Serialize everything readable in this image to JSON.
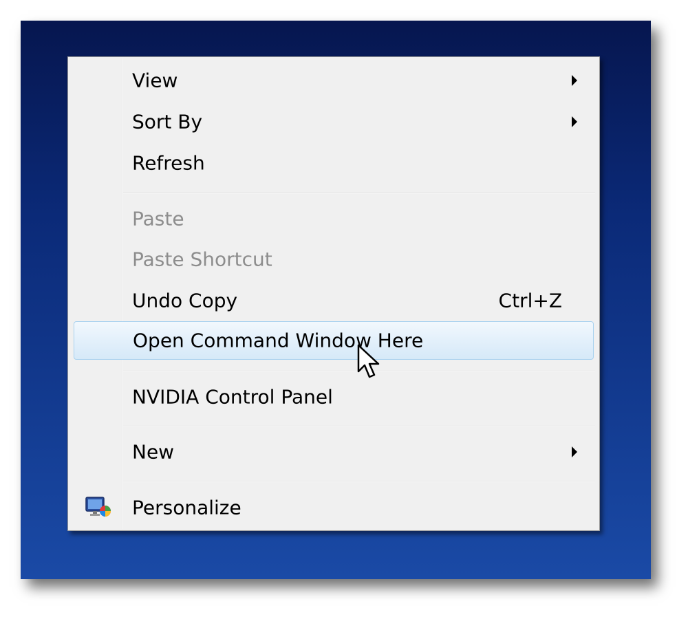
{
  "menu": {
    "items": [
      {
        "label": "View",
        "submenu": true,
        "enabled": true
      },
      {
        "label": "Sort By",
        "submenu": true,
        "enabled": true
      },
      {
        "label": "Refresh",
        "submenu": false,
        "enabled": true
      },
      {
        "label": "Paste",
        "submenu": false,
        "enabled": false
      },
      {
        "label": "Paste Shortcut",
        "submenu": false,
        "enabled": false
      },
      {
        "label": "Undo Copy",
        "shortcut": "Ctrl+Z",
        "submenu": false,
        "enabled": true
      },
      {
        "label": "Open Command Window Here",
        "submenu": false,
        "enabled": true,
        "highlighted": true
      },
      {
        "label": "NVIDIA Control Panel",
        "submenu": false,
        "enabled": true
      },
      {
        "label": "New",
        "submenu": true,
        "enabled": true
      },
      {
        "label": "Personalize",
        "submenu": false,
        "enabled": true,
        "icon": "personalize-icon"
      }
    ]
  },
  "colors": {
    "menu_bg": "#f0f0f0",
    "highlight_border": "#a8d1ef",
    "disabled_text": "#8d8d8d",
    "desktop_top": "#06164f",
    "desktop_bottom": "#1a4aa6"
  }
}
